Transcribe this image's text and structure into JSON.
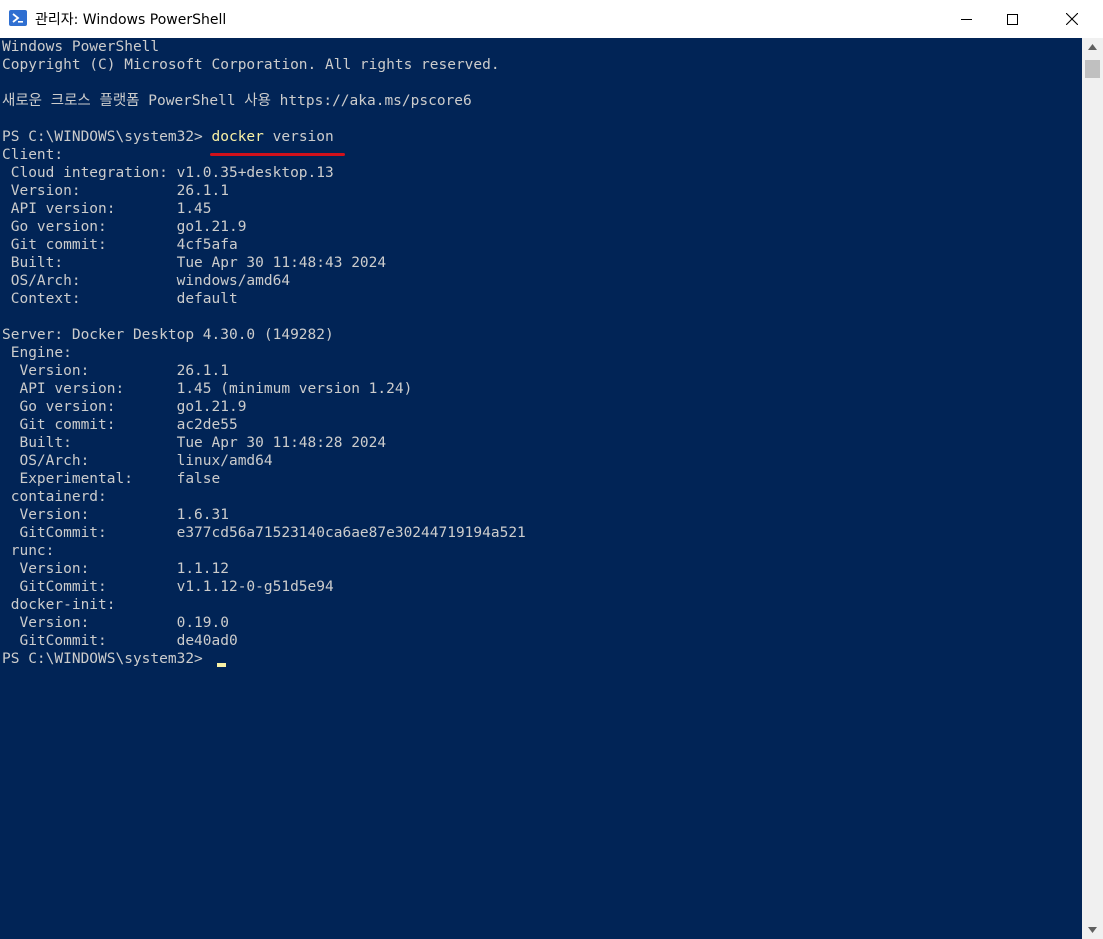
{
  "window": {
    "title": "관리자: Windows PowerShell",
    "minimize_label": "",
    "maximize_label": "",
    "close_label": ""
  },
  "terminal": {
    "prompt": "PS C:\\WINDOWS\\system32> ",
    "command_word": "docker",
    "command_rest": " version",
    "lines": [
      "Windows PowerShell",
      "Copyright (C) Microsoft Corporation. All rights reserved.",
      "",
      "새로운 크로스 플랫폼 PowerShell 사용 https://aka.ms/pscore6",
      "",
      "__CMD__",
      "Client:",
      " Cloud integration: v1.0.35+desktop.13",
      " Version:           26.1.1",
      " API version:       1.45",
      " Go version:        go1.21.9",
      " Git commit:        4cf5afa",
      " Built:             Tue Apr 30 11:48:43 2024",
      " OS/Arch:           windows/amd64",
      " Context:           default",
      "",
      "Server: Docker Desktop 4.30.0 (149282)",
      " Engine:",
      "  Version:          26.1.1",
      "  API version:      1.45 (minimum version 1.24)",
      "  Go version:       go1.21.9",
      "  Git commit:       ac2de55",
      "  Built:            Tue Apr 30 11:48:28 2024",
      "  OS/Arch:          linux/amd64",
      "  Experimental:     false",
      " containerd:",
      "  Version:          1.6.31",
      "  GitCommit:        e377cd56a71523140ca6ae87e30244719194a521",
      " runc:",
      "  Version:          1.1.12",
      "  GitCommit:        v1.1.12-0-g51d5e94",
      " docker-init:",
      "  Version:          0.19.0",
      "  GitCommit:        de40ad0",
      "__PROMPT__"
    ]
  },
  "colors": {
    "background": "#012456",
    "text": "#cccccc",
    "command": "#f9f1a5",
    "annotation_underline": "#d1111b"
  },
  "icons": [
    "powershell-icon",
    "minimize-icon",
    "maximize-icon",
    "close-icon",
    "scroll-up-icon",
    "scroll-down-icon"
  ]
}
